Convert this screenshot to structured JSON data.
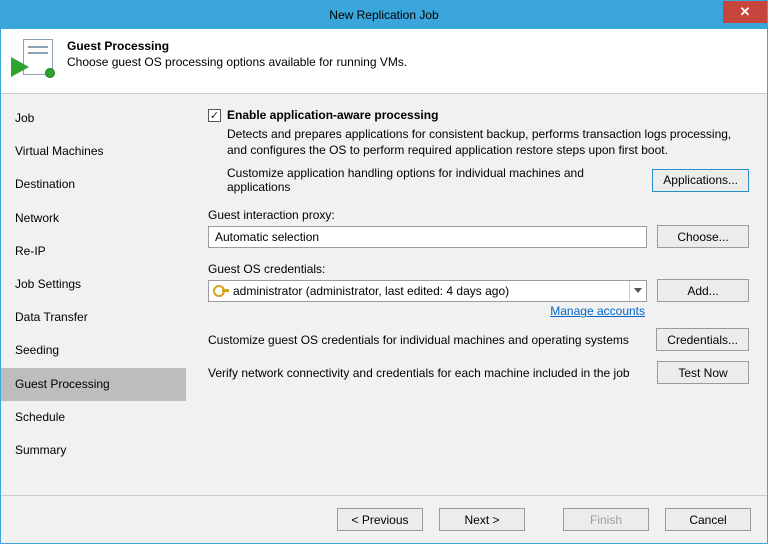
{
  "window": {
    "title": "New Replication Job"
  },
  "header": {
    "title": "Guest Processing",
    "subtitle": "Choose guest OS processing options available for running VMs."
  },
  "sidebar": {
    "items": [
      {
        "label": "Job"
      },
      {
        "label": "Virtual Machines"
      },
      {
        "label": "Destination"
      },
      {
        "label": "Network"
      },
      {
        "label": "Re-IP"
      },
      {
        "label": "Job Settings"
      },
      {
        "label": "Data Transfer"
      },
      {
        "label": "Seeding"
      },
      {
        "label": "Guest Processing",
        "active": true
      },
      {
        "label": "Schedule"
      },
      {
        "label": "Summary"
      }
    ]
  },
  "main": {
    "enable_checkbox_checked": true,
    "enable_label": "Enable application-aware processing",
    "enable_description": "Detects and prepares applications for consistent backup, performs transaction logs processing, and configures the OS to perform required application restore steps upon first boot.",
    "customize_apps_text": "Customize application handling options for individual machines and applications",
    "applications_button": "Applications...",
    "proxy_label": "Guest interaction proxy:",
    "proxy_value": "Automatic selection",
    "choose_button": "Choose...",
    "creds_label": "Guest OS credentials:",
    "creds_value": "administrator (administrator, last edited: 4 days ago)",
    "add_button": "Add...",
    "manage_link": "Manage accounts",
    "customize_creds_text": "Customize guest OS credentials for individual machines and operating systems",
    "credentials_button": "Credentials...",
    "verify_text": "Verify network connectivity and credentials for each machine included in the job",
    "test_button": "Test Now"
  },
  "footer": {
    "previous": "< Previous",
    "next": "Next >",
    "finish": "Finish",
    "cancel": "Cancel"
  }
}
